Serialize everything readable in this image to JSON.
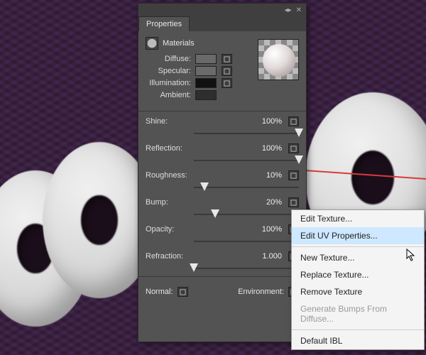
{
  "panel": {
    "title_tab": "Properties",
    "section_title": "Materials",
    "material": {
      "diffuse_label": "Diffuse:",
      "specular_label": "Specular:",
      "illumination_label": "Illumination:",
      "ambient_label": "Ambient:"
    },
    "sliders": {
      "shine": {
        "label": "Shine:",
        "value": "100%",
        "pos": 100
      },
      "reflection": {
        "label": "Reflection:",
        "value": "100%",
        "pos": 100
      },
      "roughness": {
        "label": "Roughness:",
        "value": "10%",
        "pos": 10
      },
      "bump": {
        "label": "Bump:",
        "value": "20%",
        "pos": 20
      },
      "opacity": {
        "label": "Opacity:",
        "value": "100%",
        "pos": 100
      },
      "refraction": {
        "label": "Refraction:",
        "value": "1.000",
        "pos": 0
      }
    },
    "bottom": {
      "normal_label": "Normal:",
      "environment_label": "Environment:"
    }
  },
  "context_menu": {
    "edit_texture": "Edit Texture...",
    "edit_uv": "Edit UV Properties...",
    "new_texture": "New Texture...",
    "replace_texture": "Replace Texture...",
    "remove_texture": "Remove Texture",
    "gen_bumps": "Generate Bumps From Diffuse...",
    "default_ibl": "Default IBL"
  }
}
